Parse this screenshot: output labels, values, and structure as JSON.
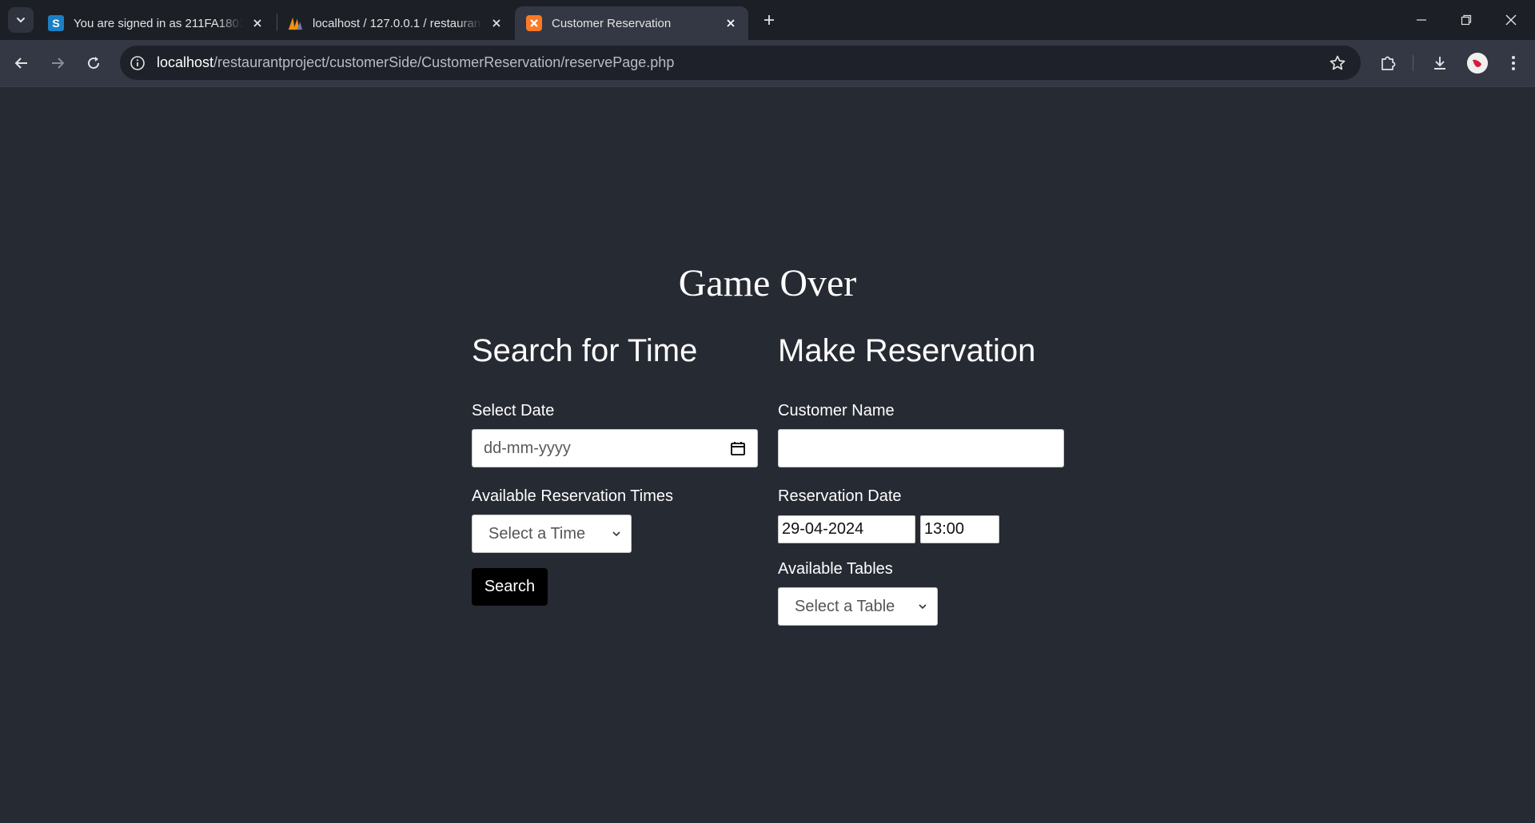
{
  "browser": {
    "tabs": [
      {
        "title": "You are signed in as 211FA1801",
        "favicon": "S",
        "active": false
      },
      {
        "title": "localhost / 127.0.0.1 / restauran",
        "favicon": "phpmyadmin-icon",
        "active": false
      },
      {
        "title": "Customer Reservation",
        "favicon": "xampp-icon",
        "active": true
      }
    ],
    "url_host": "localhost",
    "url_path": "/restaurantproject/customerSide/CustomerReservation/reservePage.php"
  },
  "page": {
    "title": "Game Over",
    "search": {
      "heading": "Search for Time",
      "date_label": "Select Date",
      "date_placeholder": "dd-mm-yyyy",
      "times_label": "Available Reservation Times",
      "times_selected": "Select a Time",
      "search_button": "Search"
    },
    "reservation": {
      "heading": "Make Reservation",
      "name_label": "Customer Name",
      "name_value": "",
      "date_label": "Reservation Date",
      "date_value": "29-04-2024",
      "time_value": "13:00",
      "tables_label": "Available Tables",
      "tables_selected": "Select a Table"
    }
  },
  "colors": {
    "page_bg": "#262a33",
    "tabbar_bg": "#1c1f26",
    "toolbar_bg": "#343844",
    "button_bg": "#000000"
  }
}
